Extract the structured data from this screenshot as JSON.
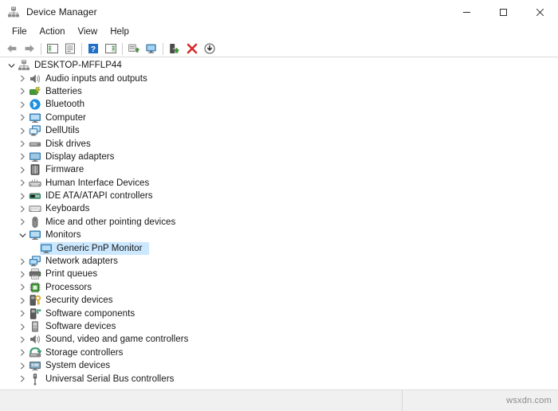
{
  "window": {
    "title": "Device Manager",
    "app_icon": "device-manager-icon"
  },
  "caption": {
    "minimize_label": "Minimize",
    "maximize_label": "Maximize",
    "close_label": "Close"
  },
  "menubar": {
    "items": [
      {
        "label": "File",
        "name": "menu-file"
      },
      {
        "label": "Action",
        "name": "menu-action"
      },
      {
        "label": "View",
        "name": "menu-view"
      },
      {
        "label": "Help",
        "name": "menu-help"
      }
    ]
  },
  "toolbar": {
    "buttons": [
      {
        "icon": "back-arrow-icon",
        "label": "Back"
      },
      {
        "icon": "forward-arrow-icon",
        "label": "Forward"
      },
      {
        "icon": "show-hide-console-tree-icon",
        "label": "Show/Hide Console Tree"
      },
      {
        "icon": "properties-icon",
        "label": "Properties"
      },
      {
        "icon": "help-icon",
        "label": "Help"
      },
      {
        "icon": "view-devices-icon",
        "label": "View"
      },
      {
        "icon": "update-driver-icon",
        "label": "Update driver"
      },
      {
        "icon": "scan-hardware-changes-icon",
        "label": "Scan for hardware changes"
      },
      {
        "icon": "enable-device-icon",
        "label": "Enable device"
      },
      {
        "icon": "uninstall-device-icon",
        "label": "Uninstall device"
      },
      {
        "icon": "disable-device-icon",
        "label": "Disable device"
      }
    ]
  },
  "tree": {
    "nodes": [
      {
        "label": "DESKTOP-MFFLP44",
        "level": 0,
        "state": "expanded",
        "icon": "computer-root-icon",
        "selected": false
      },
      {
        "label": "Audio inputs and outputs",
        "level": 1,
        "state": "collapsed",
        "icon": "speaker-icon",
        "selected": false
      },
      {
        "label": "Batteries",
        "level": 1,
        "state": "collapsed",
        "icon": "battery-icon",
        "selected": false
      },
      {
        "label": "Bluetooth",
        "level": 1,
        "state": "collapsed",
        "icon": "bluetooth-icon",
        "selected": false
      },
      {
        "label": "Computer",
        "level": 1,
        "state": "collapsed",
        "icon": "monitor-icon",
        "selected": false
      },
      {
        "label": "DellUtils",
        "level": 1,
        "state": "collapsed",
        "icon": "dell-utils-icon",
        "selected": false
      },
      {
        "label": "Disk drives",
        "level": 1,
        "state": "collapsed",
        "icon": "disk-drive-icon",
        "selected": false
      },
      {
        "label": "Display adapters",
        "level": 1,
        "state": "collapsed",
        "icon": "display-adapter-icon",
        "selected": false
      },
      {
        "label": "Firmware",
        "level": 1,
        "state": "collapsed",
        "icon": "firmware-icon",
        "selected": false
      },
      {
        "label": "Human Interface Devices",
        "level": 1,
        "state": "collapsed",
        "icon": "hid-icon",
        "selected": false
      },
      {
        "label": "IDE ATA/ATAPI controllers",
        "level": 1,
        "state": "collapsed",
        "icon": "ide-controller-icon",
        "selected": false
      },
      {
        "label": "Keyboards",
        "level": 1,
        "state": "collapsed",
        "icon": "keyboard-icon",
        "selected": false
      },
      {
        "label": "Mice and other pointing devices",
        "level": 1,
        "state": "collapsed",
        "icon": "mouse-icon",
        "selected": false
      },
      {
        "label": "Monitors",
        "level": 1,
        "state": "expanded",
        "icon": "monitor-icon",
        "selected": false
      },
      {
        "label": "Generic PnP Monitor",
        "level": 2,
        "state": "leaf",
        "icon": "monitor-icon",
        "selected": true
      },
      {
        "label": "Network adapters",
        "level": 1,
        "state": "collapsed",
        "icon": "network-adapter-icon",
        "selected": false
      },
      {
        "label": "Print queues",
        "level": 1,
        "state": "collapsed",
        "icon": "printer-icon",
        "selected": false
      },
      {
        "label": "Processors",
        "level": 1,
        "state": "collapsed",
        "icon": "processor-icon",
        "selected": false
      },
      {
        "label": "Security devices",
        "level": 1,
        "state": "collapsed",
        "icon": "security-device-icon",
        "selected": false
      },
      {
        "label": "Software components",
        "level": 1,
        "state": "collapsed",
        "icon": "software-component-icon",
        "selected": false
      },
      {
        "label": "Software devices",
        "level": 1,
        "state": "collapsed",
        "icon": "software-device-icon",
        "selected": false
      },
      {
        "label": "Sound, video and game controllers",
        "level": 1,
        "state": "collapsed",
        "icon": "speaker-icon",
        "selected": false
      },
      {
        "label": "Storage controllers",
        "level": 1,
        "state": "collapsed",
        "icon": "storage-controller-icon",
        "selected": false
      },
      {
        "label": "System devices",
        "level": 1,
        "state": "collapsed",
        "icon": "system-device-icon",
        "selected": false
      },
      {
        "label": "Universal Serial Bus controllers",
        "level": 1,
        "state": "collapsed",
        "icon": "usb-icon",
        "selected": false
      }
    ]
  },
  "statusbar": {
    "left_text": "",
    "watermark": "wsxdn.com"
  },
  "colors": {
    "selection": "#cce8ff",
    "window_bg": "#ffffff",
    "statusbar_bg": "#f0f0f0",
    "text": "#171717",
    "accent_blue": "#3b8fd4",
    "red": "#d42b2b",
    "green": "#3f9c35"
  }
}
